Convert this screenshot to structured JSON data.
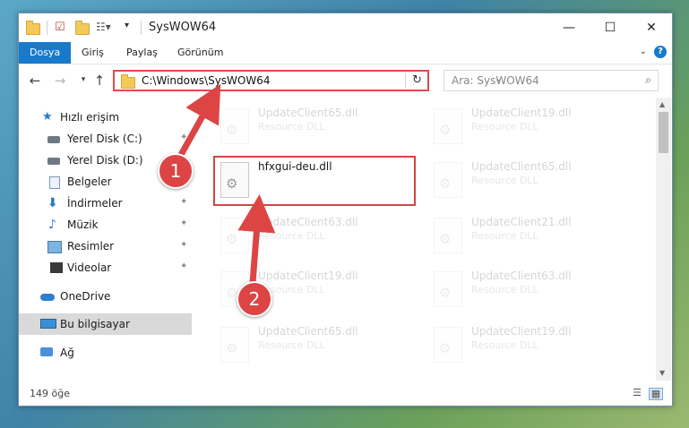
{
  "window": {
    "title": "SysWOW64",
    "buttons": {
      "minimize": "—",
      "maximize": "☐",
      "close": "✕"
    }
  },
  "ribbon": {
    "tabs": [
      "Dosya",
      "Giriş",
      "Paylaş",
      "Görünüm"
    ],
    "help": "?"
  },
  "address": {
    "path": "C:\\Windows\\SysWOW64",
    "search_placeholder": "Ara: SysWOW64"
  },
  "nav": {
    "items": [
      {
        "label": "Hızlı erişim",
        "icon": "star-icon",
        "pinned": false
      },
      {
        "label": "Yerel Disk (C:)",
        "icon": "drive-icon",
        "pinned": true
      },
      {
        "label": "Yerel Disk (D:)",
        "icon": "drive-icon",
        "pinned": true
      },
      {
        "label": "Belgeler",
        "icon": "documents-icon",
        "pinned": true
      },
      {
        "label": "İndirmeler",
        "icon": "downloads-icon",
        "pinned": true
      },
      {
        "label": "Müzik",
        "icon": "music-icon",
        "pinned": true
      },
      {
        "label": "Resimler",
        "icon": "pictures-icon",
        "pinned": true
      },
      {
        "label": "Videolar",
        "icon": "videos-icon",
        "pinned": true
      },
      {
        "label": "OneDrive",
        "icon": "onedrive-icon",
        "pinned": false
      },
      {
        "label": "Bu bilgisayar",
        "icon": "this-pc-icon",
        "pinned": false,
        "selected": true
      },
      {
        "label": "Ağ",
        "icon": "network-icon",
        "pinned": false
      }
    ]
  },
  "files": {
    "highlighted": {
      "name": "hfxgui-deu.dll"
    },
    "left_column": [
      {
        "name": "UpdateClient65.dll",
        "desc": "Resource DLL"
      },
      {
        "name": "UpdateClient63.dll",
        "desc": "Resource DLL"
      },
      {
        "name": "UpdateClient19.dll",
        "desc": "Resource DLL"
      },
      {
        "name": "UpdateClient65.dll",
        "desc": "Resource DLL"
      }
    ],
    "right_column": [
      {
        "name": "UpdateClient19.dll",
        "desc": "Resource DLL"
      },
      {
        "name": "UpdateClient65.dll",
        "desc": "Resource DLL"
      },
      {
        "name": "UpdateClient21.dll",
        "desc": "Resource DLL"
      },
      {
        "name": "UpdateClient63.dll",
        "desc": "Resource DLL"
      },
      {
        "name": "UpdateClient19.dll",
        "desc": "Resource DLL"
      }
    ]
  },
  "status": {
    "count": "149 öğe"
  },
  "callouts": {
    "one": "1",
    "two": "2"
  },
  "colors": {
    "accent": "#1979ca",
    "callout": "#dd4545",
    "highlight_border": "#d24545"
  }
}
